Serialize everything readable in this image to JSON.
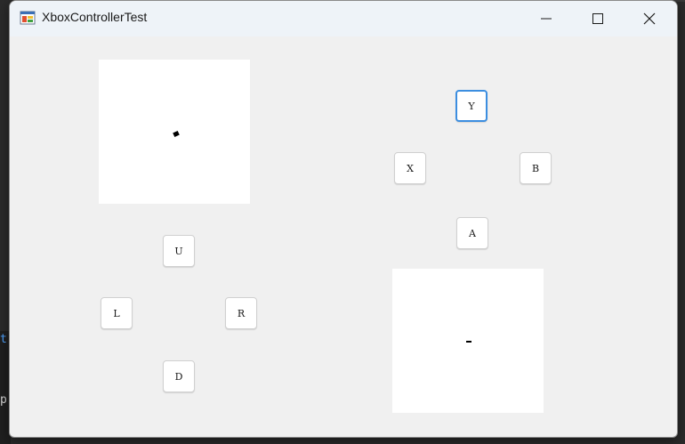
{
  "window": {
    "title": "XboxControllerTest",
    "caption_buttons": [
      "minimize-icon",
      "maximize-icon",
      "close-icon"
    ]
  },
  "dpad": {
    "up": "U",
    "left": "L",
    "right": "R",
    "down": "D"
  },
  "face_buttons": {
    "y": "Y",
    "x": "X",
    "b": "B",
    "a": "A",
    "focused": "Y"
  },
  "background_app": {
    "glyphs": [
      "t",
      "p"
    ]
  },
  "colors": {
    "focus_accent": "#3c8ee0",
    "panel": "#ffffff",
    "window_bg": "#f0f0f0"
  }
}
